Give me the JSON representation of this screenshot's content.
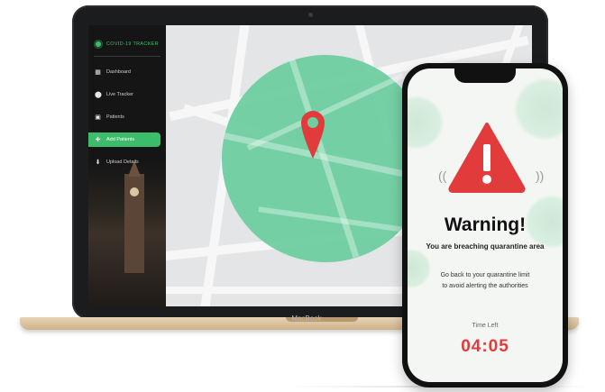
{
  "laptop": {
    "model_label": "MacBook",
    "brand": "COVID-19 TRACKER",
    "nav_items": [
      {
        "label": "Dashboard",
        "icon": "grid-icon"
      },
      {
        "label": "Live Tracker",
        "icon": "location-pin-icon"
      },
      {
        "label": "Patients",
        "icon": "id-card-icon"
      },
      {
        "label": "Add Patients",
        "icon": "add-user-icon"
      },
      {
        "label": "Upload Details",
        "icon": "upload-icon"
      }
    ],
    "active_nav_index": 3,
    "colors": {
      "accent": "#3cbd6b",
      "sidebar_bg": "#151515",
      "zone": "#6ecea0",
      "pin": "#e23b3b"
    }
  },
  "phone": {
    "warning_title": "Warning!",
    "warning_subtitle": "You are breaching quarantine area",
    "message_line1": "Go back to your quarantine limit",
    "message_line2": "to avoid alerting the authorities",
    "time_label": "Time Left",
    "time_value": "04:05",
    "colors": {
      "alert": "#e23b3b"
    }
  }
}
